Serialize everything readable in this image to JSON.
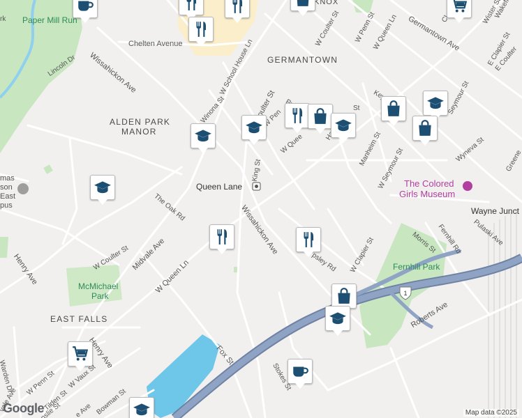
{
  "map": {
    "areas": [
      {
        "id": "germantown",
        "text": "GERMANTOWN"
      },
      {
        "id": "alden-park-manor-1",
        "text": "ALDEN PARK"
      },
      {
        "id": "alden-park-manor-2",
        "text": "MANOR"
      },
      {
        "id": "east-falls",
        "text": "EAST FALLS"
      }
    ],
    "parks": [
      {
        "id": "paper-mill-run",
        "text": "Paper Mill Run"
      },
      {
        "id": "mcmichael-park-1",
        "text": "McMichael"
      },
      {
        "id": "mcmichael-park-2",
        "text": "Park"
      },
      {
        "id": "fernhill-park",
        "text": "Fernhill Park"
      }
    ],
    "poi": [
      {
        "id": "colored-girls-museum-1",
        "text": "The Colored"
      },
      {
        "id": "colored-girls-museum-2",
        "text": "Girls Museum"
      }
    ],
    "station": {
      "text": "Queen Lane"
    },
    "streets": [
      {
        "id": "chelten-ave",
        "text": "Chelten Avenue"
      },
      {
        "id": "wissahickon-ave-north",
        "text": "Wissahickon Ave"
      },
      {
        "id": "lincoln-dr",
        "text": "Lincoln Dr"
      },
      {
        "id": "w-school-house-ln",
        "text": "W School House Ln"
      },
      {
        "id": "winona-st",
        "text": "Winona St"
      },
      {
        "id": "coulter-st",
        "text": "Coulter St"
      },
      {
        "id": "king-st",
        "text": "King St"
      },
      {
        "id": "w-coulter-st-north",
        "text": "W Coulter St"
      },
      {
        "id": "w-queen-ln-north",
        "text": "W Queen Ln"
      },
      {
        "id": "w-penn-st-north",
        "text": "W Penn St"
      },
      {
        "id": "germantown-ave",
        "text": "Germantown Ave"
      },
      {
        "id": "wister-st",
        "text": "Wister St"
      },
      {
        "id": "e-clapier-st",
        "text": "E Clapier St"
      },
      {
        "id": "wakefield",
        "text": "Wakefield"
      },
      {
        "id": "e-coulter",
        "text": "E Coulter"
      },
      {
        "id": "seymour-st",
        "text": "Seymour St"
      },
      {
        "id": "manheim-st",
        "text": "Manheim St"
      },
      {
        "id": "w-seymour-st",
        "text": "W Seymour St"
      },
      {
        "id": "wyneva-st",
        "text": "Wyneva St"
      },
      {
        "id": "greene",
        "text": "Greene"
      },
      {
        "id": "wayne-junct",
        "text": "Wayne Junct"
      },
      {
        "id": "fernhill-rd",
        "text": "Fernhill Rd"
      },
      {
        "id": "pulaski-ave",
        "text": "Pulaski Ave"
      },
      {
        "id": "morris-st",
        "text": "Morris St"
      },
      {
        "id": "w-clapier-st",
        "text": "W Clapier St"
      },
      {
        "id": "apsley-rd",
        "text": "psley Rd"
      },
      {
        "id": "wissahickon-ave-south",
        "text": "Wissahickon Ave"
      },
      {
        "id": "the-oak-rd",
        "text": "The Oak Rd"
      },
      {
        "id": "w-coulter-st-south",
        "text": "W Coulter St"
      },
      {
        "id": "midvale-ave",
        "text": "Midvale Ave"
      },
      {
        "id": "w-queen-ln-south",
        "text": "W Queen Ln"
      },
      {
        "id": "henry-ave-west",
        "text": "Henry Ave"
      },
      {
        "id": "henry-ave-south",
        "text": "Henry Ave"
      },
      {
        "id": "fox-st",
        "text": "Fox St"
      },
      {
        "id": "stokes-st",
        "text": "Stokes St"
      },
      {
        "id": "roberts-ave",
        "text": "Roberts Ave"
      },
      {
        "id": "w-penn-st-south",
        "text": "W Penn St"
      },
      {
        "id": "tilden-st",
        "text": "Tilden St"
      },
      {
        "id": "w-vaux-st",
        "text": "W Vaux St"
      },
      {
        "id": "warden-dr",
        "text": "Warden Dr"
      },
      {
        "id": "vale-ave",
        "text": "vale Ave"
      },
      {
        "id": "bowman-st",
        "text": "Bowman St"
      },
      {
        "id": "nslie-st",
        "text": "nslie St"
      },
      {
        "id": "e-ave",
        "text": "e Ave"
      },
      {
        "id": "knox",
        "text": "KNOX"
      },
      {
        "id": "keys",
        "text": "Key"
      },
      {
        "id": "pul",
        "text": "Pul"
      },
      {
        "id": "ha",
        "text": "Ha"
      },
      {
        "id": "w-pen",
        "text": "W Pen"
      },
      {
        "id": "w-quee",
        "text": "W Quee"
      },
      {
        "id": "ma",
        "text": "ma"
      },
      {
        "id": "rk",
        "text": "rk"
      },
      {
        "id": "st",
        "text": "St"
      },
      {
        "id": "cl",
        "text": "Cl"
      },
      {
        "id": "chas",
        "text": "mas"
      },
      {
        "id": "son",
        "text": "son"
      },
      {
        "id": "east",
        "text": "East"
      },
      {
        "id": "pus",
        "text": "pus"
      }
    ],
    "shield": {
      "text": "1"
    },
    "pins": [
      {
        "id": "cafe-top",
        "icon": "coffee-icon"
      },
      {
        "id": "restaurant-top-1",
        "icon": "restaurant-icon"
      },
      {
        "id": "restaurant-top-2",
        "icon": "restaurant-icon"
      },
      {
        "id": "restaurant-chelten",
        "icon": "restaurant-icon"
      },
      {
        "id": "shop-top",
        "icon": "shopping-bag-icon"
      },
      {
        "id": "grocery-top",
        "icon": "shopping-cart-icon"
      },
      {
        "id": "school-winona",
        "icon": "school-icon"
      },
      {
        "id": "school-king",
        "icon": "school-icon"
      },
      {
        "id": "restaurant-coulter",
        "icon": "restaurant-icon"
      },
      {
        "id": "shop-coulter",
        "icon": "shopping-bag-icon"
      },
      {
        "id": "school-high",
        "icon": "school-icon"
      },
      {
        "id": "school-manheim",
        "icon": "school-icon"
      },
      {
        "id": "shop-manheim-1",
        "icon": "shopping-bag-icon"
      },
      {
        "id": "shop-manheim-2",
        "icon": "shopping-bag-icon"
      },
      {
        "id": "school-oak",
        "icon": "school-icon"
      },
      {
        "id": "restaurant-midvale",
        "icon": "restaurant-icon"
      },
      {
        "id": "restaurant-apsley",
        "icon": "restaurant-icon"
      },
      {
        "id": "shop-expressway",
        "icon": "shopping-bag-icon"
      },
      {
        "id": "school-expressway",
        "icon": "school-icon"
      },
      {
        "id": "grocery-henry",
        "icon": "shopping-cart-icon"
      },
      {
        "id": "cafe-stokes",
        "icon": "coffee-icon"
      },
      {
        "id": "school-bottom",
        "icon": "school-icon"
      }
    ],
    "logo": {
      "text": "Google"
    },
    "attribution": {
      "text": "Map data ©2025"
    },
    "colors": {
      "land": "#f1f0ee",
      "road": "#ffffff",
      "park": "#c8e6c0",
      "water": "#6ec6e8",
      "highway": "#8a9bb8",
      "commercial": "#fbeecb",
      "icon": "#1d4f73",
      "poi": "#b03fa0"
    }
  }
}
